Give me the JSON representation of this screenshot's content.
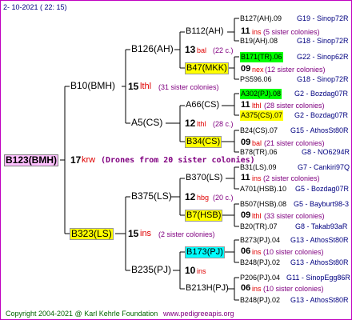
{
  "header": {
    "date": "2- 10-2021 ( 22: 15)"
  },
  "root": {
    "label": "B123(BMH)",
    "num": "17",
    "colony": "krw",
    "note": "(Drones from 20 sister colonies)"
  },
  "gen1": [
    {
      "label": "B10(BMH)",
      "num": "15",
      "colony": "lthl",
      "sis": "(31 sister colonies)"
    },
    {
      "label": "B323(LS)",
      "num": "15",
      "colony": "ins",
      "sis": "(2 sister colonies)"
    }
  ],
  "gen2": [
    {
      "label": "B126(AH)",
      "num": "13",
      "colony": "bal",
      "sis": "(22 c.)"
    },
    {
      "label": "A5(CS)",
      "num": "12",
      "colony": "lthl",
      "sis": "(28 c.)"
    },
    {
      "label": "B375(LS)",
      "num": "12",
      "colony": "hbg",
      "sis": "(20 c.)"
    },
    {
      "label": "B235(PJ)",
      "num": "10",
      "colony": "ins",
      "sis": ""
    }
  ],
  "gen3": [
    {
      "label": "B112(AH)",
      "num": "11",
      "colony": "ins",
      "sis": "(5 sister colonies)"
    },
    {
      "label": "B47(MKK)",
      "num": "09",
      "colony": "nex",
      "sis": "(12 sister colonies)"
    },
    {
      "label": "A66(CS)",
      "num": "11",
      "colony": "lthl",
      "sis": "(28 sister colonies)"
    },
    {
      "label": "B34(CS)",
      "num": "09",
      "colony": "bal",
      "sis": "(21 sister colonies)"
    },
    {
      "label": "B370(LS)",
      "num": "11",
      "colony": "ins",
      "sis": "(2 sister colonies)"
    },
    {
      "label": "B7(HSB)",
      "num": "09",
      "colony": "lthl",
      "sis": "(33 sister colonies)"
    },
    {
      "label": "B173(PJ)",
      "num": "06",
      "colony": "ins",
      "sis": "(10 sister colonies)"
    },
    {
      "label": "B213H(PJ)",
      "num": "06",
      "colony": "ins",
      "sis": "(10 sister colonies)"
    }
  ],
  "gen4": [
    {
      "label": "B127(AH).09",
      "side": "G19 - Sinop72R"
    },
    {
      "label": "B19(AH).08",
      "side": "G18 - Sinop72R"
    },
    {
      "label": "B171(TR).06",
      "side": "G22 - Sinop62R"
    },
    {
      "label": "PS596.06",
      "side": "G18 - Sinop72R"
    },
    {
      "label": "A302(PJ).08",
      "side": "G2 - Bozdag07R"
    },
    {
      "label": "A375(CS).07",
      "side": "G2 - Bozdag07R"
    },
    {
      "label": "B24(CS).07",
      "side": "G15 - AthosSt80R"
    },
    {
      "label": "B78(TR).06",
      "side": "G8 - NO6294R"
    },
    {
      "label": "B31(LS).09",
      "side": "G7 - Cankiri97Q"
    },
    {
      "label": "A701(HSB).10",
      "side": "G5 - Bozdag07R"
    },
    {
      "label": "B507(HSB).08",
      "side": "G5 - Bayburt98-3"
    },
    {
      "label": "B20(TR).07",
      "side": "G8 - Takab93aR"
    },
    {
      "label": "B273(PJ).04",
      "side": "G13 - AthosSt80R"
    },
    {
      "label": "B248(PJ).02",
      "side": "G13 - AthosSt80R"
    },
    {
      "label": "P206(PJ).04",
      "side": "G11 - SinopEgg86R"
    },
    {
      "label": "B248(PJ).02",
      "side": "G13 - AthosSt80R"
    }
  ],
  "footer": {
    "copyright": "Copyright 2004-2021 @ Karl Kehrle Foundation",
    "url": "www.pedigreeapis.org"
  },
  "colors": {
    "frame": "#c000c0",
    "highlight_yellow": "#ffff00",
    "highlight_green": "#00ff00",
    "highlight_cyan": "#00ffff",
    "root_bg": "#ffc0ff",
    "red": "#e00000",
    "purple": "#800080",
    "navy": "#000080"
  }
}
